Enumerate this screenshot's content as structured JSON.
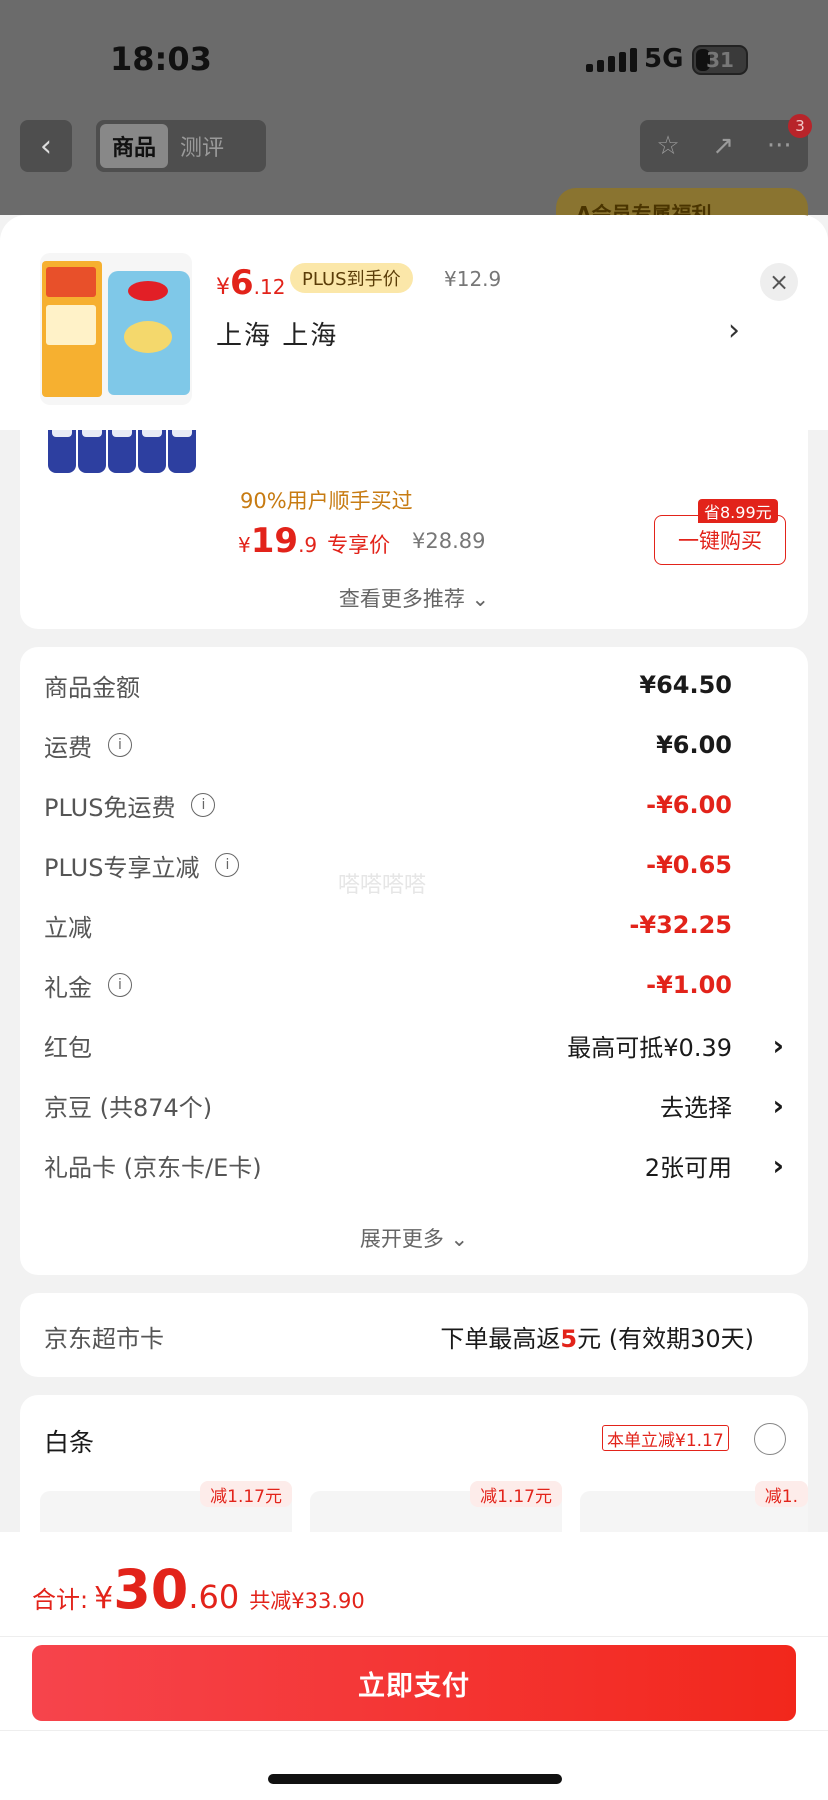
{
  "status_bar": {
    "time": "18:03",
    "network": "5G",
    "battery": "31"
  },
  "nav": {
    "back_icon": "‹",
    "tabs": [
      {
        "label": "商品",
        "active": true
      },
      {
        "label": "测评",
        "active": false
      }
    ],
    "tools": [
      "star-icon",
      "share-icon",
      "more-icon"
    ],
    "badge_count": "3",
    "banner_text": "A会员专属福利"
  },
  "header": {
    "price_currency": "¥",
    "price_int": "6",
    "price_dec": ".12",
    "plus_tag": "PLUS到手价",
    "original_price": "¥12.9",
    "location": "上海  上海",
    "arrow": "›",
    "close": "×"
  },
  "recommendation": {
    "note": "90%用户顺手买过",
    "price_currency": "¥",
    "price_int": "19",
    "price_dec": ".9",
    "price_label": "专享价",
    "original_price": "¥28.89",
    "save_tag": "省8.99元",
    "buy_label": "一键购买",
    "more_label": "查看更多推荐 ⌄"
  },
  "summary": {
    "rows": [
      {
        "label": "商品金额",
        "value": "¥64.50"
      },
      {
        "label": "运费",
        "value": "¥6.00"
      },
      {
        "label": "PLUS免运费",
        "value": "-¥6.00"
      },
      {
        "label": "PLUS专享立减",
        "value": "-¥0.65"
      },
      {
        "label": "立减",
        "value": "-¥32.25"
      },
      {
        "label": "礼金",
        "value": "-¥1.00"
      },
      {
        "label": "红包",
        "value": "最高可抵¥0.39"
      },
      {
        "label": "京豆 (共874个)",
        "value": "去选择"
      },
      {
        "label": "礼品卡 (京东卡/E卡)",
        "value": "2张可用"
      }
    ],
    "expand_label": "展开更多 ⌄",
    "watermark": "嗒嗒嗒嗒"
  },
  "market_card": {
    "label": "京东超市卡",
    "value_prefix": "下单最高返",
    "value_amount": "5",
    "value_suffix": "元 (有效期30天)"
  },
  "baitiao": {
    "title": "白条",
    "tag": "本单立减¥1.17",
    "plan_tags": [
      "减1.17元",
      "减1.17元",
      "减1."
    ]
  },
  "bottom": {
    "total_label": "合计:",
    "total_currency": "¥",
    "total_int": "30",
    "total_dec": ".60",
    "total_save": "共减¥33.90",
    "pay_label": "立即支付"
  },
  "colors": {
    "accent": "#e2231a",
    "plus_gold": "#fbe7a9",
    "note_orange": "#c77b12"
  }
}
